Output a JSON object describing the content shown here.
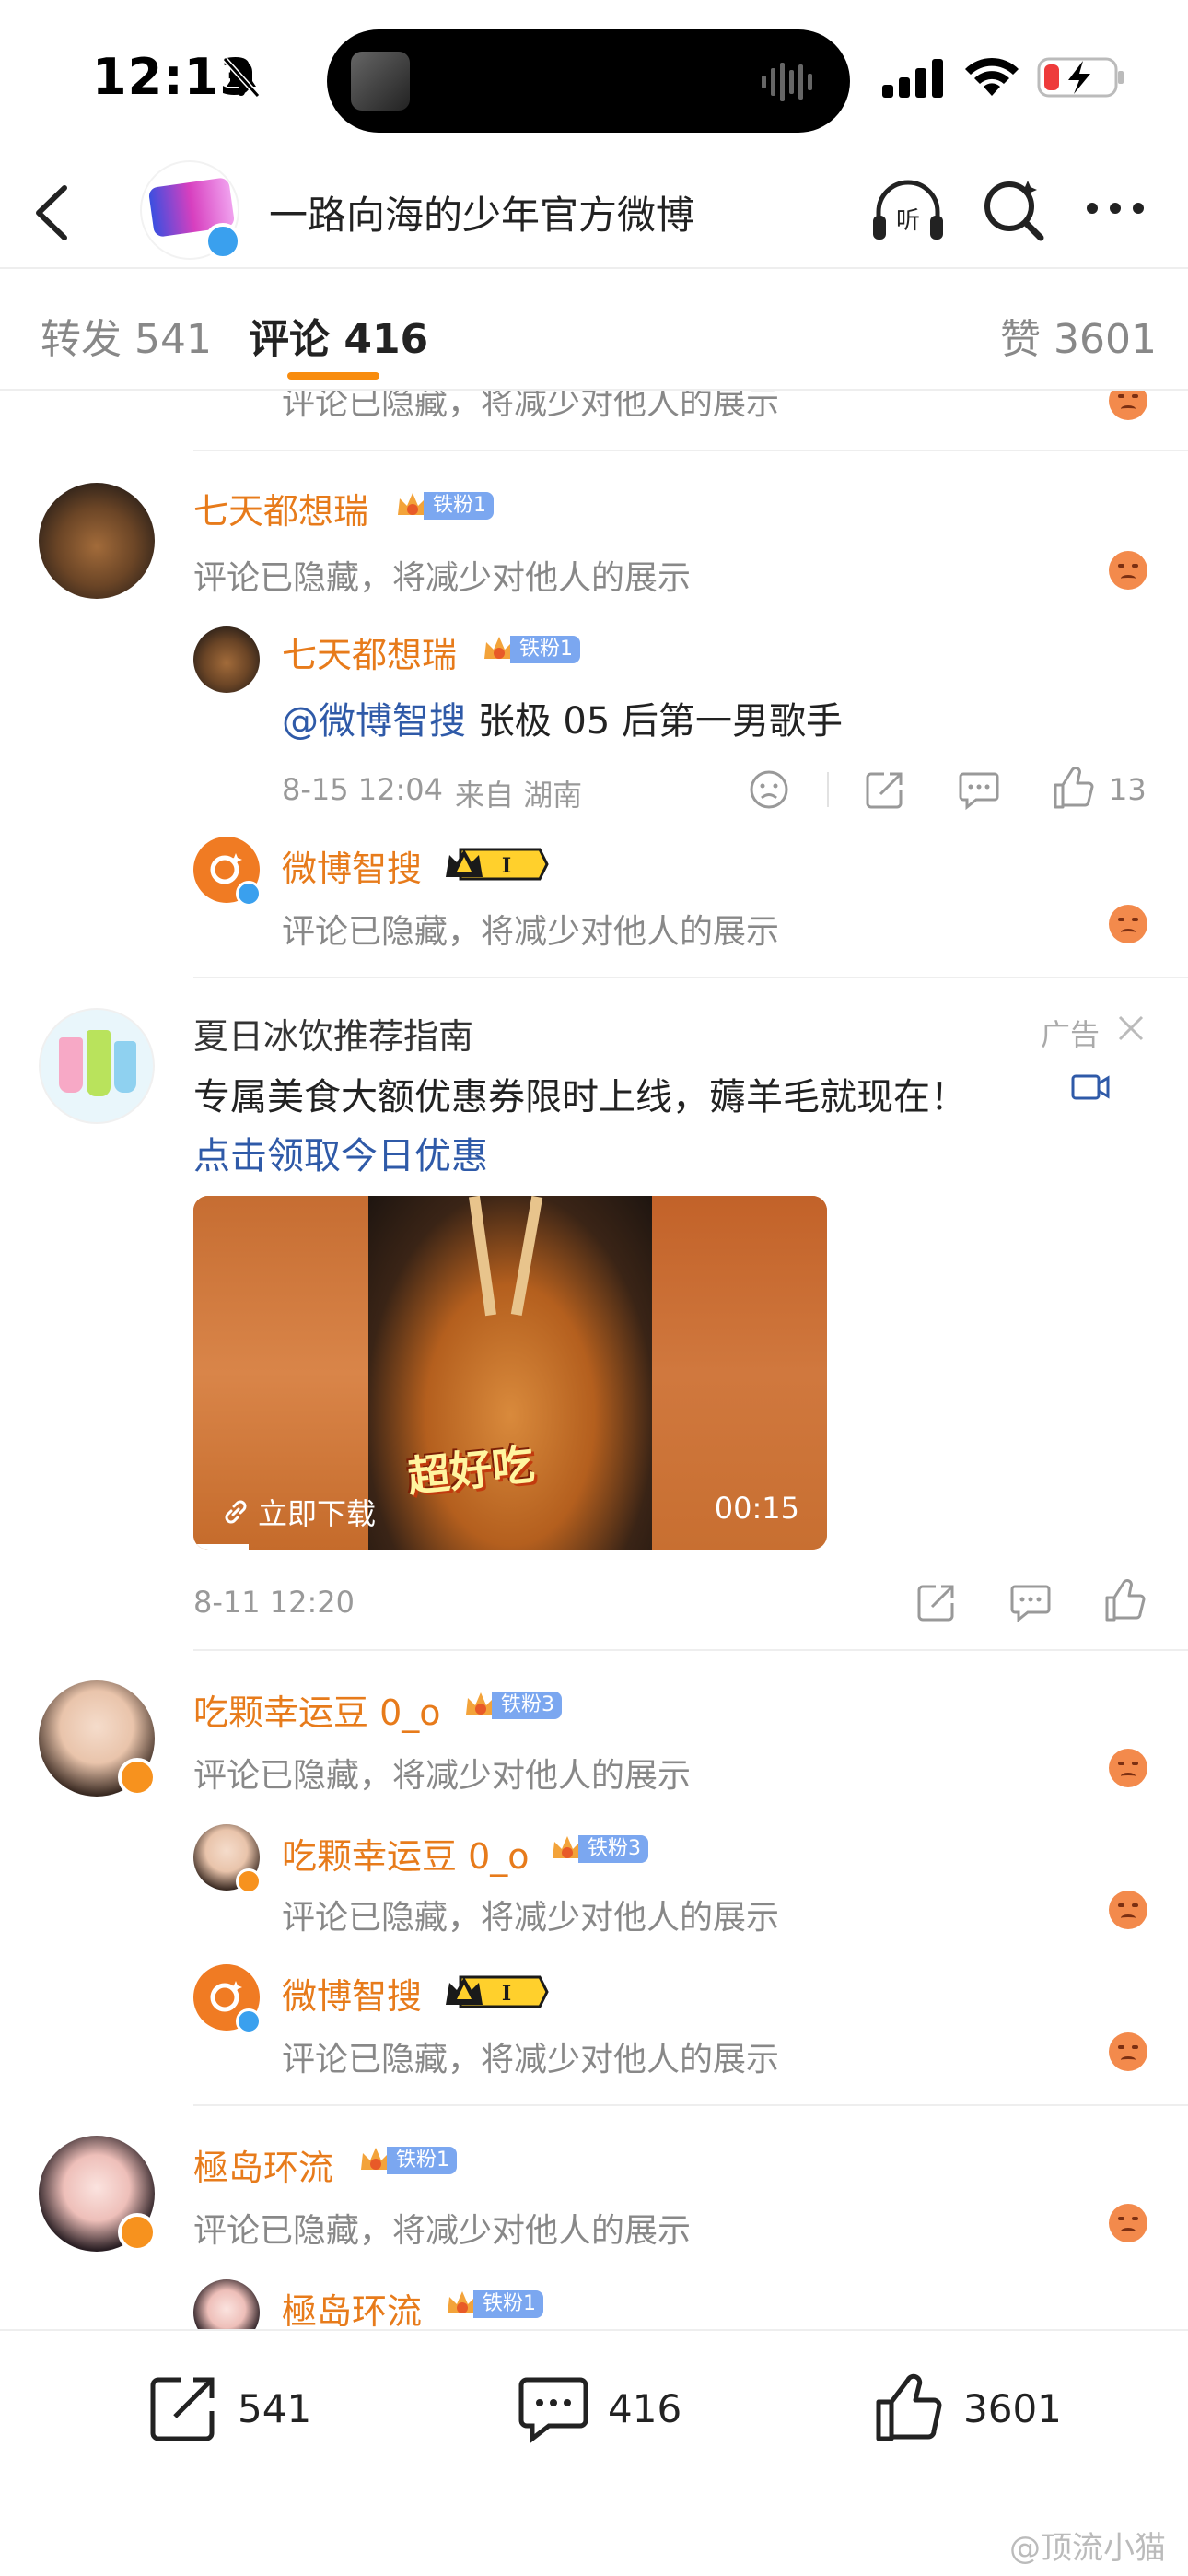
{
  "status_bar": {
    "time": "12:13"
  },
  "nav": {
    "title": "一路向海的少年官方微博"
  },
  "tabs": {
    "repost": {
      "label": "转发",
      "count": "541"
    },
    "comment": {
      "label": "评论",
      "count": "416"
    },
    "like": {
      "label": "赞",
      "count": "3601"
    }
  },
  "common": {
    "hidden_text": "评论已隐藏，将减少对他人的展示"
  },
  "comments": [
    {
      "user": "七天都想瑞",
      "fan_badge": "铁粉1",
      "text": "评论已隐藏，将减少对他人的展示",
      "replies": [
        {
          "user": "七天都想瑞",
          "fan_badge": "铁粉1",
          "mention": "@微博智搜",
          "text": "张极 05 后第一男歌手",
          "date": "8-15 12:04",
          "location": "来自 湖南",
          "likes": "13"
        },
        {
          "user": "微博智搜",
          "vip_level": "I",
          "text": "评论已隐藏，将减少对他人的展示"
        }
      ]
    },
    {
      "user": "吃颗幸运豆 0_o",
      "fan_badge": "铁粉3",
      "text": "评论已隐藏，将减少对他人的展示",
      "replies": [
        {
          "user": "吃颗幸运豆 0_o",
          "fan_badge": "铁粉3",
          "text": "评论已隐藏，将减少对他人的展示"
        },
        {
          "user": "微博智搜",
          "vip_level": "I",
          "text": "评论已隐藏，将减少对他人的展示"
        }
      ]
    },
    {
      "user": "極岛环流",
      "fan_badge": "铁粉1",
      "text": "评论已隐藏，将减少对他人的展示",
      "replies": [
        {
          "user": "極岛环流",
          "fan_badge": "铁粉1"
        }
      ]
    }
  ],
  "ad": {
    "advertiser": "夏日冰饮推荐指南",
    "ad_label": "广告",
    "text": "专属美食大额优惠券限时上线，薅羊毛就现在！",
    "link_text": "点击领取今日优惠",
    "image_caption": "超好吃",
    "download_label": "立即下载",
    "duration": "00:15",
    "date": "8-11 12:20"
  },
  "bottom_bar": {
    "repost_count": "541",
    "comment_count": "416",
    "like_count": "3601"
  },
  "watermark": "@顶流小猫",
  "colors": {
    "accent": "#f88c0e",
    "username": "#e77b1b",
    "link": "#2f5aa8",
    "fan_badge": "#7ba7f0"
  }
}
